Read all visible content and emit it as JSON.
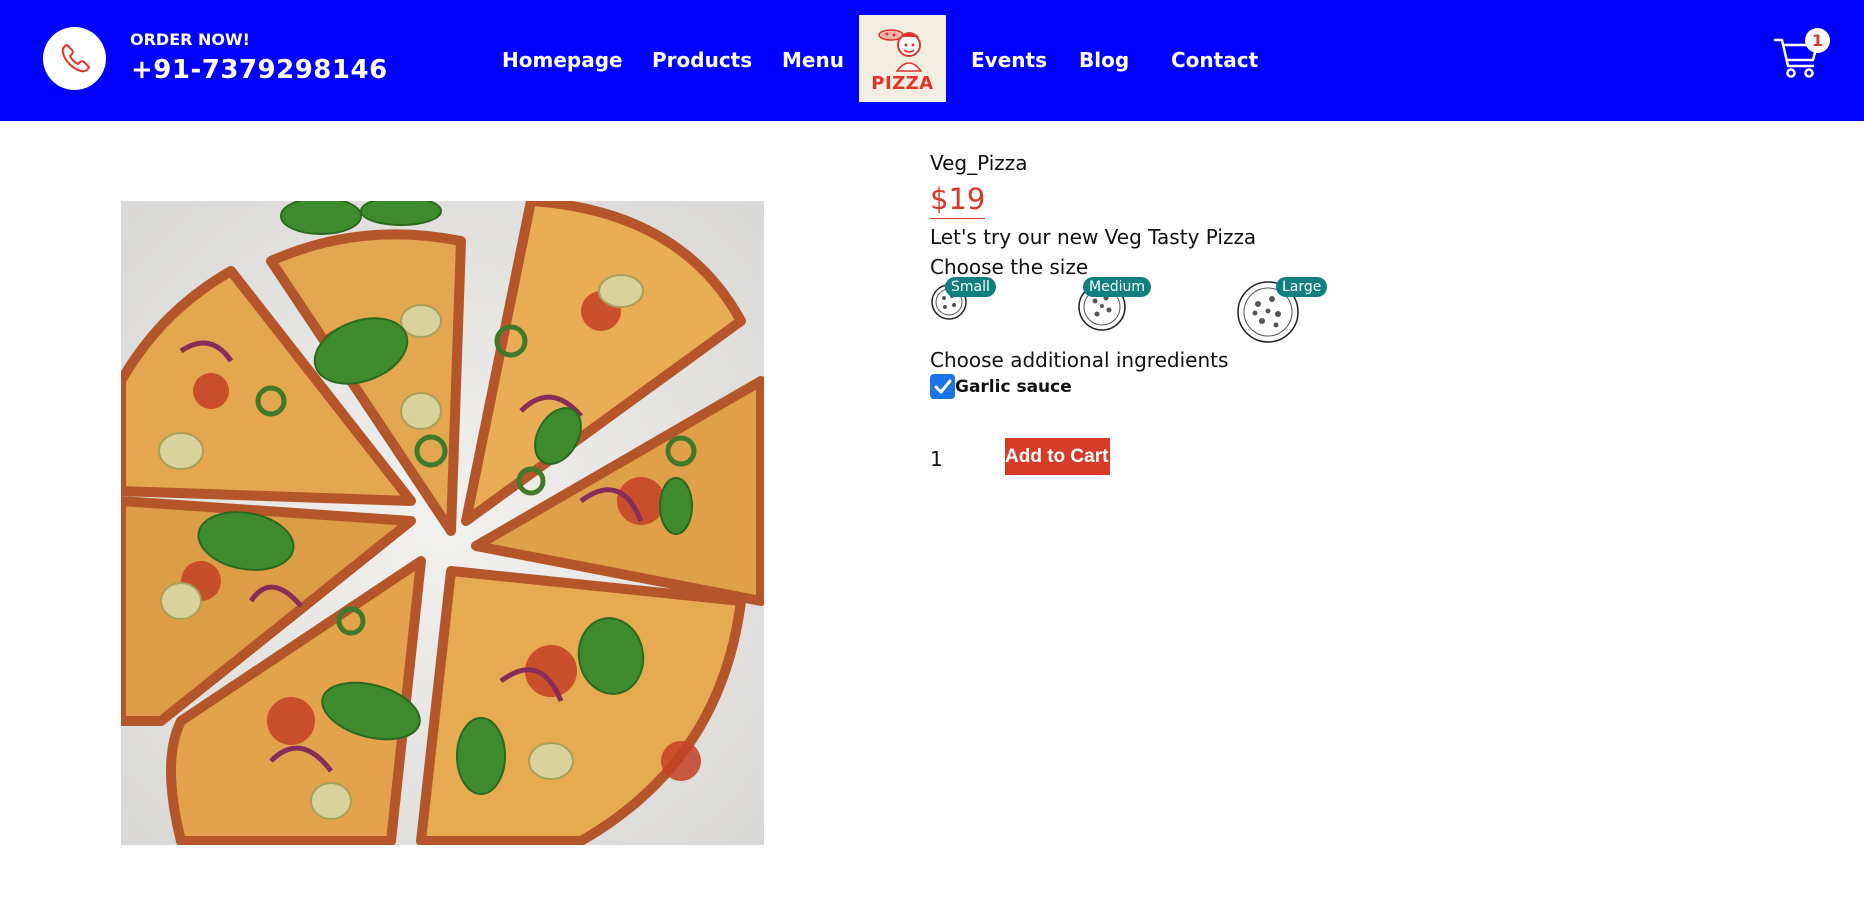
{
  "header": {
    "order_now": "ORDER NOW!",
    "phone": "+91-7379298146",
    "nav": [
      "Homepage",
      "Products",
      "Menu",
      "Events",
      "Blog",
      "Contact"
    ],
    "logo_text": "PIZZA",
    "cart_count": "1",
    "background": "#0000ff"
  },
  "product": {
    "name": "Veg_Pizza",
    "price": "$19",
    "description": "Let's try our new Veg Tasty Pizza",
    "size_label": "Choose the size",
    "sizes": [
      "Small",
      "Medium",
      "Large"
    ],
    "ingredients_label": "Choose additional ingredients",
    "ingredient": {
      "label": "Garlic sauce",
      "checked": true
    },
    "quantity": "1",
    "add_to_cart": "Add to Cart",
    "accent": "#d63a28",
    "badge_color": "#0f7f7f"
  },
  "icons": {
    "phone": "phone-icon",
    "cart": "cart-icon",
    "logo": "pizza-chef-logo",
    "checkbox": "check-icon"
  }
}
